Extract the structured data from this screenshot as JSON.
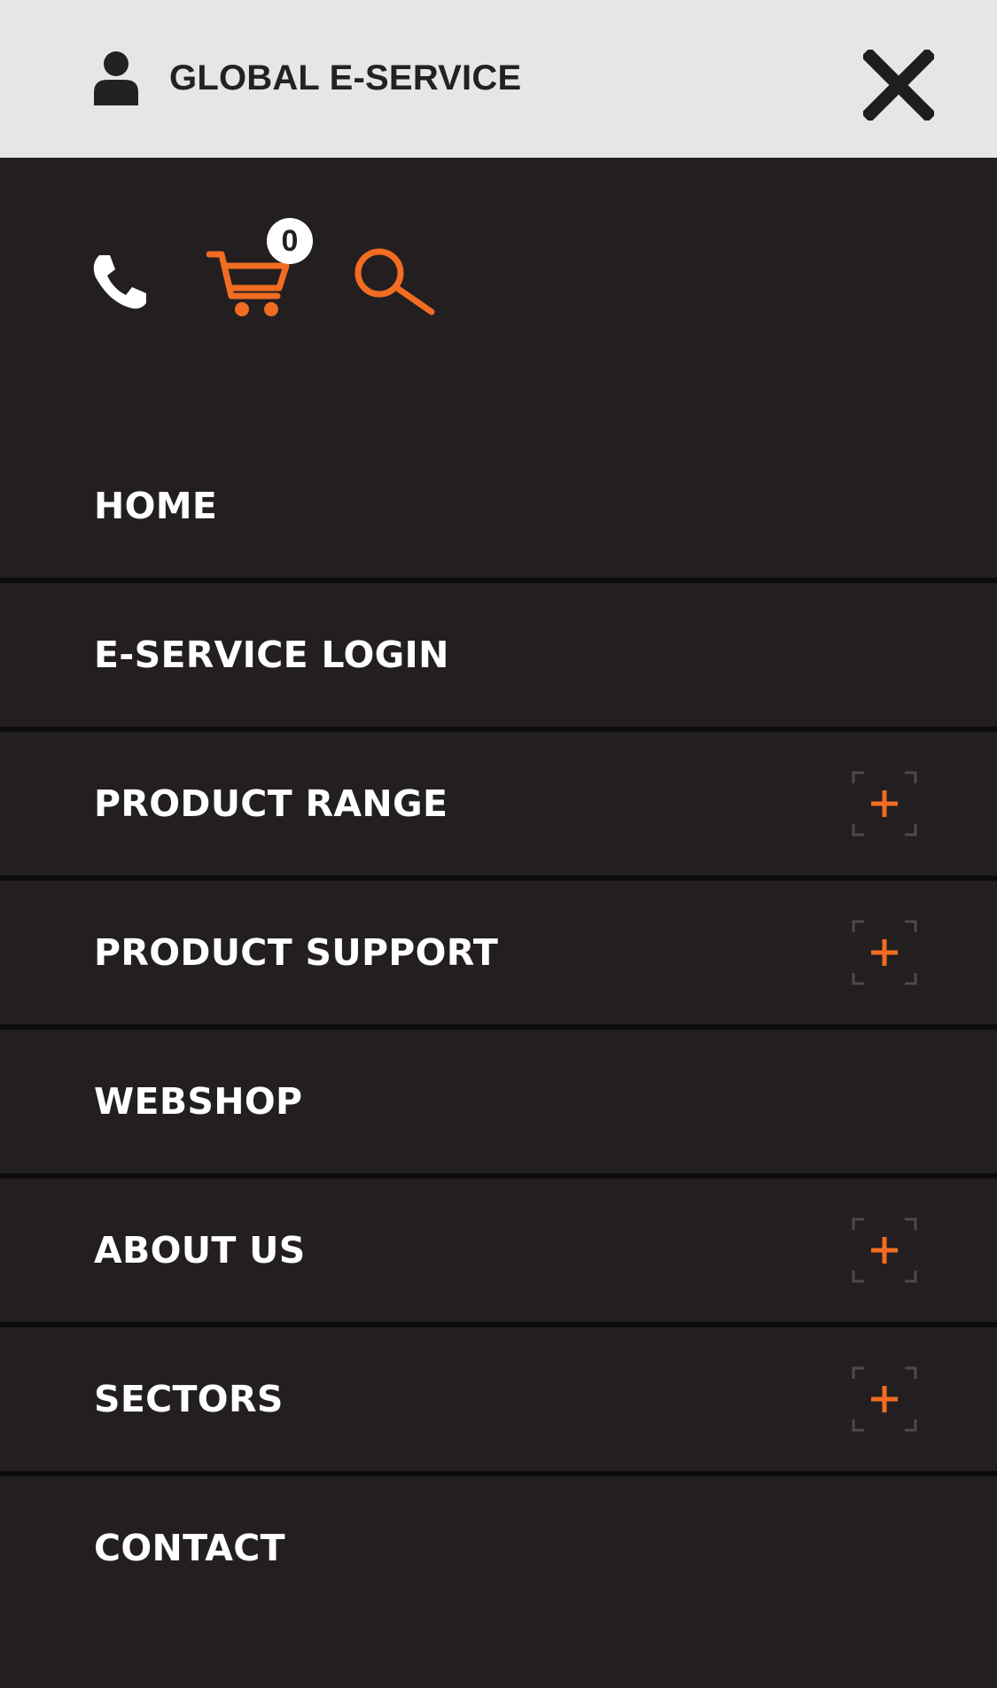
{
  "header": {
    "account_label": "GLOBAL E-SERVICE",
    "account_icon": "user-icon",
    "close_icon": "close-icon"
  },
  "tools": {
    "phone_icon": "phone-icon",
    "cart_icon": "cart-icon",
    "cart_count": "0",
    "search_icon": "search-icon"
  },
  "nav": {
    "items": [
      {
        "label": "HOME",
        "expandable": false
      },
      {
        "label": "E-SERVICE LOGIN",
        "expandable": false
      },
      {
        "label": "PRODUCT RANGE",
        "expandable": true
      },
      {
        "label": "PRODUCT SUPPORT",
        "expandable": true
      },
      {
        "label": "WEBSHOP",
        "expandable": false
      },
      {
        "label": "ABOUT US",
        "expandable": true
      },
      {
        "label": "SECTORS",
        "expandable": true
      },
      {
        "label": "CONTACT",
        "expandable": false
      }
    ],
    "expand_icon": "plus-icon"
  },
  "colors": {
    "menu_background": "#231f20",
    "header_background": "#e6e6e6",
    "accent": "#f26c22",
    "divider": "#0d0c0c",
    "text": "#ffffff"
  }
}
